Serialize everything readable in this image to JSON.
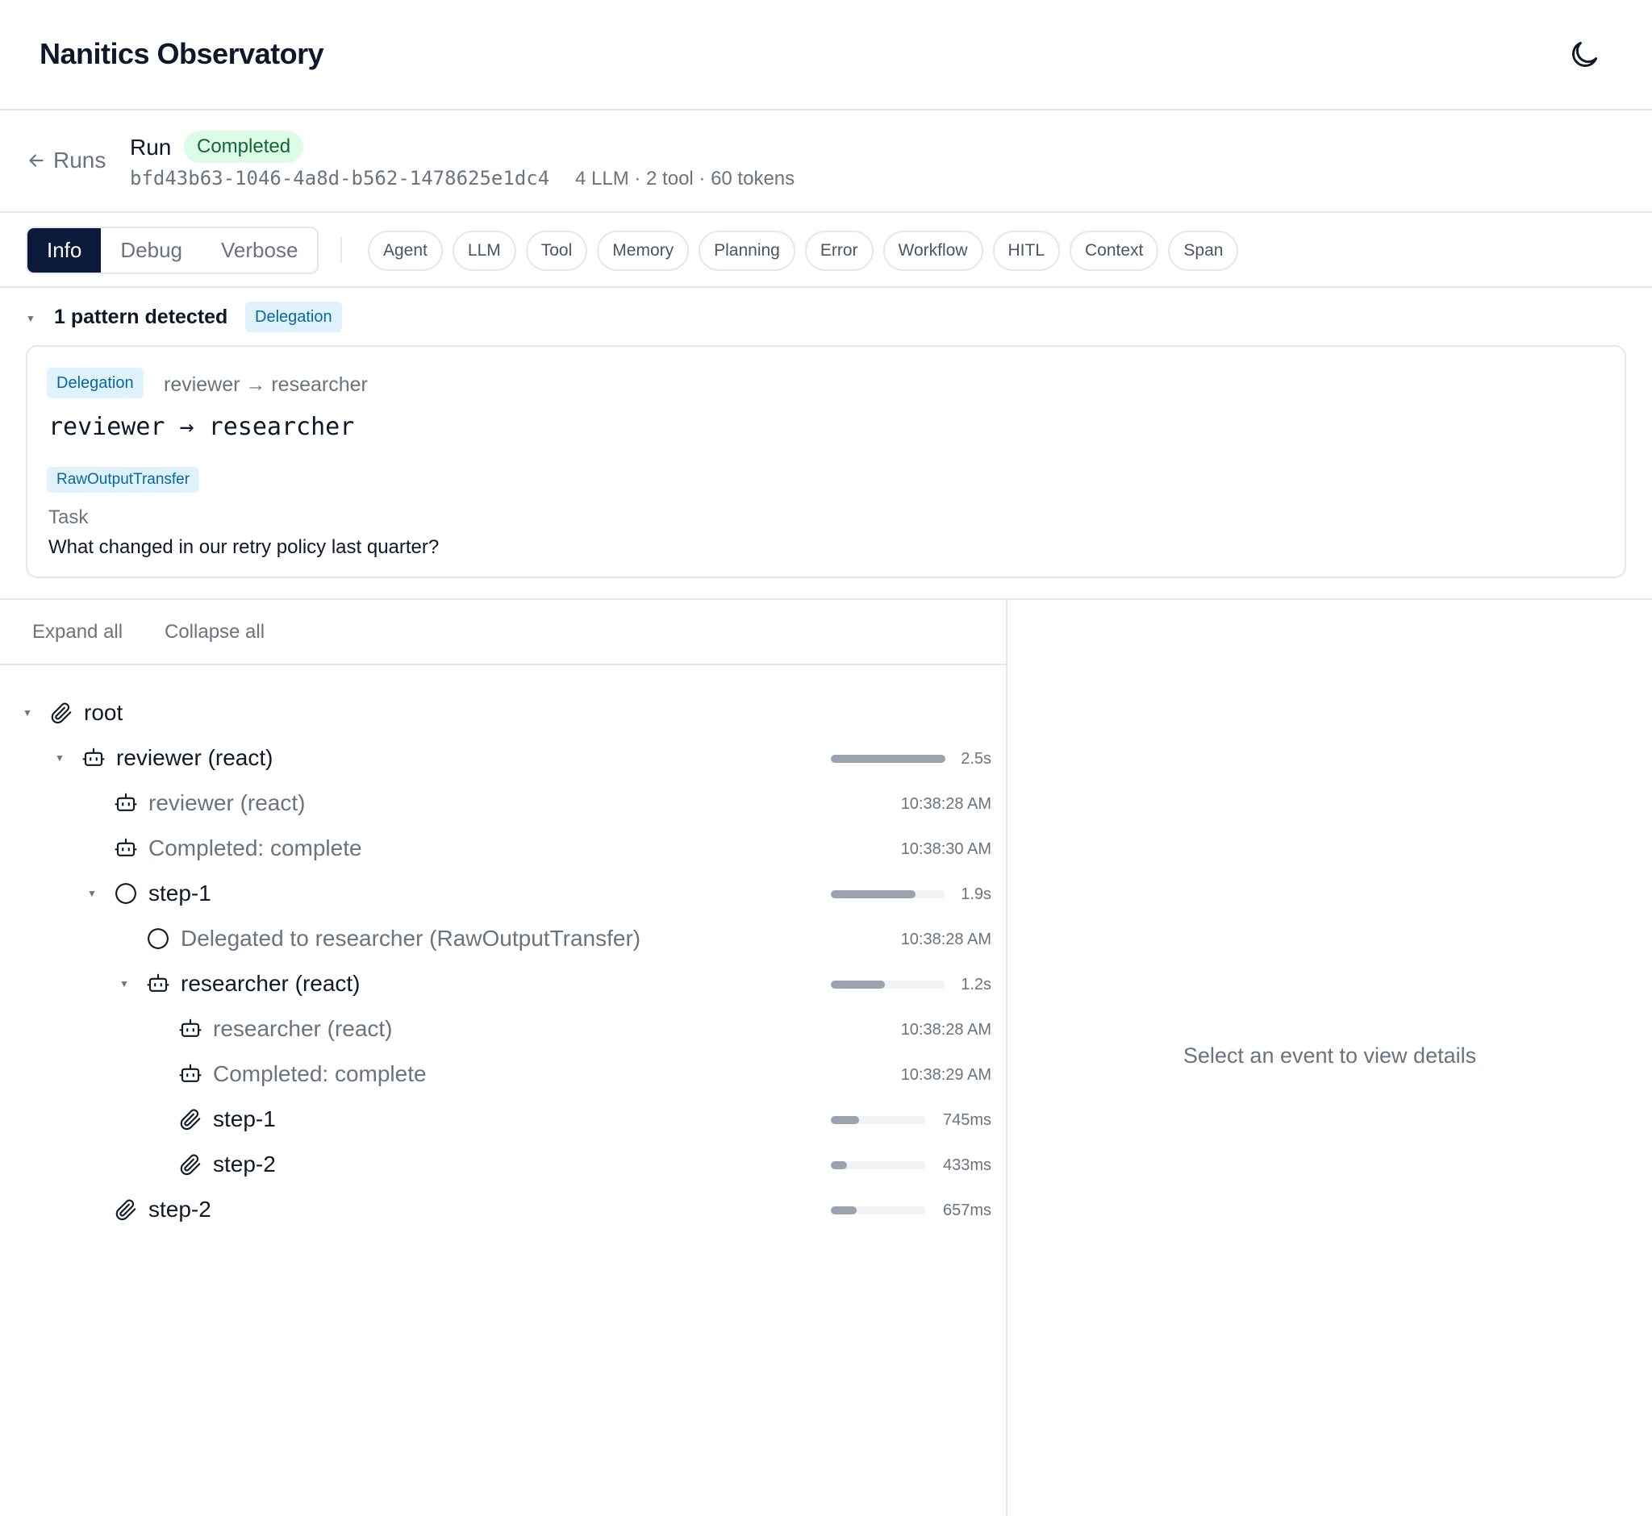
{
  "app": {
    "title": "Nanitics Observatory"
  },
  "run": {
    "back_label": "Runs",
    "label": "Run",
    "status": "Completed",
    "id": "bfd43b63-1046-4a8d-b562-1478625e1dc4",
    "stats": "4 LLM · 2 tool · 60 tokens"
  },
  "levels": [
    "Info",
    "Debug",
    "Verbose"
  ],
  "active_level": "Info",
  "chips": [
    "Agent",
    "LLM",
    "Tool",
    "Memory",
    "Planning",
    "Error",
    "Workflow",
    "HITL",
    "Context",
    "Span"
  ],
  "patterns": {
    "title": "1 pattern detected",
    "tag": "Delegation",
    "card": {
      "tag": "Delegation",
      "route": "reviewer → researcher",
      "mono": "reviewer → researcher",
      "transfer": "RawOutputTransfer",
      "task_label": "Task",
      "task_value": "What changed in our retry policy last quarter?"
    }
  },
  "tree": {
    "expand_all": "Expand all",
    "collapse_all": "Collapse all",
    "rows": [
      {
        "label": "root",
        "icon": "paperclip-icon",
        "depth": 0,
        "caret": true,
        "muted": false
      },
      {
        "label": "reviewer (react)",
        "icon": "robot-icon",
        "depth": 1,
        "caret": true,
        "muted": false,
        "duration": "2.5s",
        "fraction": 1.0
      },
      {
        "label": "reviewer (react)",
        "icon": "robot-icon",
        "depth": 2,
        "caret": false,
        "muted": true,
        "time": "10:38:28 AM"
      },
      {
        "label": "Completed: complete",
        "icon": "robot-icon",
        "depth": 2,
        "caret": false,
        "muted": true,
        "time": "10:38:30 AM"
      },
      {
        "label": "step-1",
        "icon": "circle-icon",
        "depth": 2,
        "caret": true,
        "muted": false,
        "duration": "1.9s",
        "fraction": 0.74
      },
      {
        "label": "Delegated to researcher (RawOutputTransfer)",
        "icon": "circle-icon",
        "depth": 3,
        "caret": false,
        "muted": true,
        "time": "10:38:28 AM"
      },
      {
        "label": "researcher (react)",
        "icon": "robot-icon",
        "depth": 3,
        "caret": true,
        "muted": false,
        "duration": "1.2s",
        "fraction": 0.47
      },
      {
        "label": "researcher (react)",
        "icon": "robot-icon",
        "depth": 4,
        "caret": false,
        "muted": true,
        "time": "10:38:28 AM"
      },
      {
        "label": "Completed: complete",
        "icon": "robot-icon",
        "depth": 4,
        "caret": false,
        "muted": true,
        "time": "10:38:29 AM"
      },
      {
        "label": "step-1",
        "icon": "paperclip-icon",
        "depth": 4,
        "caret": false,
        "muted": false,
        "duration": "745ms",
        "fraction": 0.3
      },
      {
        "label": "step-2",
        "icon": "paperclip-icon",
        "depth": 4,
        "caret": false,
        "muted": false,
        "duration": "433ms",
        "fraction": 0.17
      },
      {
        "label": "step-2",
        "icon": "paperclip-icon",
        "depth": 2,
        "caret": false,
        "muted": false,
        "duration": "657ms",
        "fraction": 0.27
      }
    ]
  },
  "details": {
    "empty": "Select an event to view details"
  },
  "colors": {
    "accent": "#0b1a3a",
    "success_bg": "#dcfce7",
    "success_fg": "#166534",
    "tag_bg": "#e0f2fe",
    "tag_fg": "#0369a1"
  }
}
